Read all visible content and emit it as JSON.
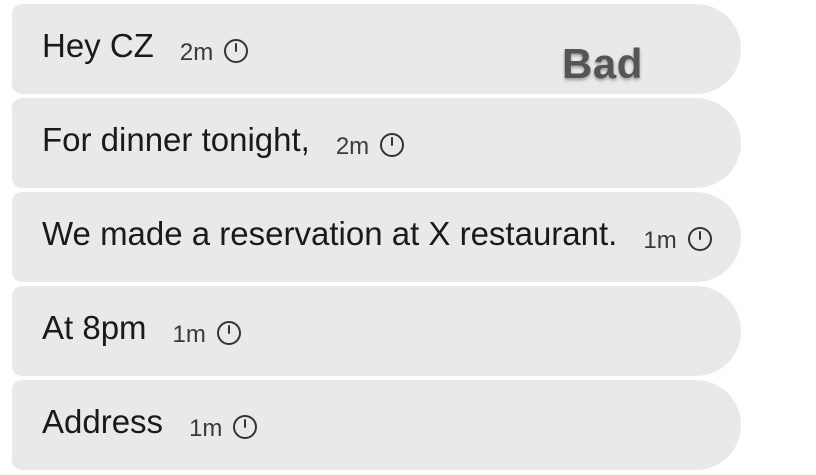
{
  "label": "Bad",
  "messages": [
    {
      "text": "Hey CZ",
      "time": "2m",
      "icon": "clock-icon"
    },
    {
      "text": "For dinner tonight,",
      "time": "2m",
      "icon": "clock-icon"
    },
    {
      "text": "We made a reservation at X restaurant.",
      "time": "1m",
      "icon": "clock-icon"
    },
    {
      "text": "At 8pm",
      "time": "1m",
      "icon": "clock-icon"
    },
    {
      "text": "Address",
      "time": "1m",
      "icon": "clock-icon"
    }
  ],
  "colors": {
    "bubble": "#e9e9e9",
    "text": "#1a1a1a",
    "label": "#555555"
  }
}
